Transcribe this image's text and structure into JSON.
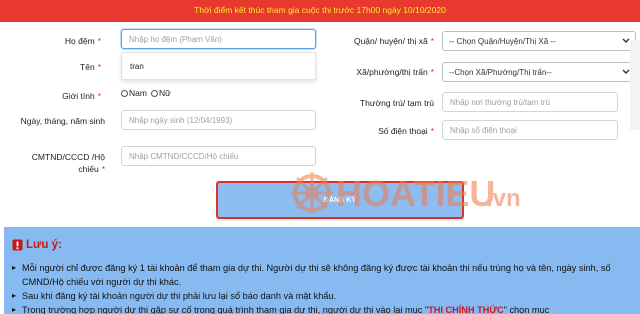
{
  "banner": {
    "text": "Thời điểm kết thúc tham gia cuộc thi trước 17h00 ngày 10/10/2020"
  },
  "form": {
    "middle_name": {
      "label": "Họ đệm",
      "value": "",
      "placeholder": "Nhập họ đệm (Phạm Văn)"
    },
    "autocomplete_item": "tran",
    "first_name": {
      "label": "Tên"
    },
    "gender": {
      "label": "Giới tính",
      "options": [
        "Nam",
        "Nữ"
      ]
    },
    "birthdate": {
      "label": "Ngày, tháng, năm sinh",
      "placeholder": "Nhập ngày sinh (12/04/1993)"
    },
    "id_card": {
      "label": "CMTND/CCCD /Hộ chiếu",
      "placeholder": "Nhập CMTND/CCCD/Hộ chiếu"
    },
    "district": {
      "label": "Quận/ huyện/ thị xã",
      "selected": "-- Chọn Quận/Huyện/Thị Xã --"
    },
    "ward": {
      "label": "Xã/phường/thị trấn",
      "selected": "--Chọn Xã/Phường/Thị trấn--"
    },
    "residence": {
      "label": "Thường trú/ tạm trú",
      "placeholder": "Nhập nơi thường trú/tạm trú"
    },
    "phone": {
      "label": "Số điện thoại",
      "placeholder": "Nhập số điện thoại"
    },
    "required_mark": "*",
    "submit_label": "ĐĂNG KÝ"
  },
  "watermark": {
    "text_main": "HOATIEU",
    "text_suffix": ".vn"
  },
  "notice": {
    "title": "Lưu ý:",
    "items": [
      "Mỗi người chỉ được đăng ký 1 tài khoản để tham gia dự thi. Người dự thi sẽ không đăng ký được tài khoản thi nếu trùng họ và tên, ngày sinh, số CMND/Hộ chiếu với người dự thi khác.",
      "Sau khi đăng ký tài khoản người dự thi phải lưu lại số báo danh và mật khẩu."
    ],
    "item3_before": "Trong trường hợp người dự thi gặp sự cố trong quá trình tham gia dự thi, người dự thi vào lại mục \"",
    "item3_highlight": "THI CHÍNH THỨC",
    "item3_after": "\" chọn mục"
  },
  "colors": {
    "banner_bg": "#e8392e",
    "banner_text": "#ffe930",
    "notice_bg": "#86baf0",
    "submit_bg": "#8dbcf0",
    "submit_border": "#d9352b",
    "required": "#e02b2b"
  },
  "icons": {
    "notice": "warning-icon",
    "dropdown": "chevron-down-icon",
    "watermark": "wheel-logo-icon"
  }
}
